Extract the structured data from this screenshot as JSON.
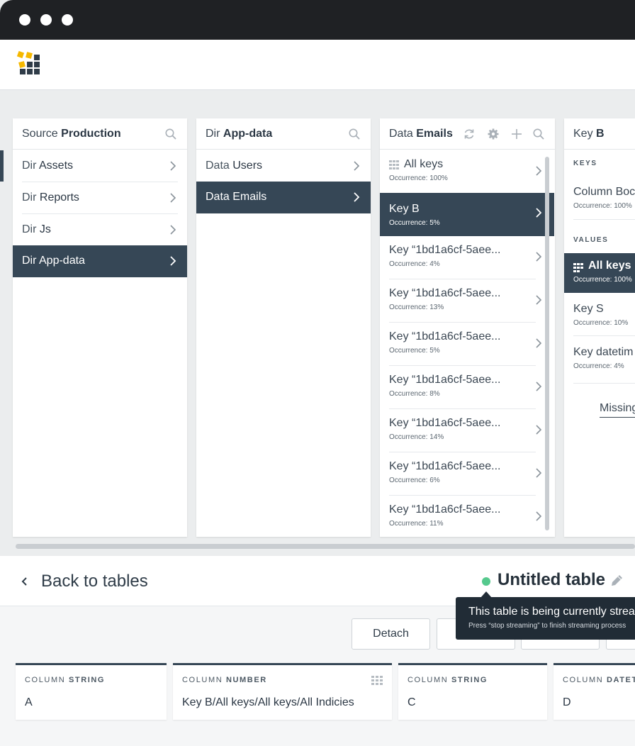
{
  "window": {
    "controls": [
      "close",
      "minimize",
      "maximize"
    ]
  },
  "app": {
    "logo_icon": "grid-logo-icon"
  },
  "panels": {
    "source": {
      "prefix": "Source",
      "name": "Production",
      "items": [
        {
          "prefix": "Dir",
          "name": "Assets"
        },
        {
          "prefix": "Dir",
          "name": "Reports"
        },
        {
          "prefix": "Dir",
          "name": "Js"
        },
        {
          "prefix": "Dir",
          "name": "App-data",
          "selected": true
        }
      ]
    },
    "dir": {
      "prefix": "Dir",
      "name": "App-data",
      "items": [
        {
          "prefix": "Data",
          "name": "Users"
        },
        {
          "prefix": "Data",
          "name": "Emails",
          "selected": true
        }
      ]
    },
    "data": {
      "prefix": "Data",
      "name": "Emails",
      "items": [
        {
          "label": "All keys",
          "occurrence": "Occurrence: 100%"
        },
        {
          "prefix": "Key",
          "name": "B",
          "occurrence": "Occurrence: 5%",
          "selected": true
        },
        {
          "prefix": "Key",
          "name": "“1bd1a6cf-5aee...",
          "occurrence": "Occurrence: 4%"
        },
        {
          "prefix": "Key",
          "name": "“1bd1a6cf-5aee...",
          "occurrence": "Occurrence: 13%"
        },
        {
          "prefix": "Key",
          "name": "“1bd1a6cf-5aee...",
          "occurrence": "Occurrence: 5%"
        },
        {
          "prefix": "Key",
          "name": "“1bd1a6cf-5aee...",
          "occurrence": "Occurrence: 8%"
        },
        {
          "prefix": "Key",
          "name": "“1bd1a6cf-5aee...",
          "occurrence": "Occurrence: 14%"
        },
        {
          "prefix": "Key",
          "name": "“1bd1a6cf-5aee...",
          "occurrence": "Occurrence: 6%"
        },
        {
          "prefix": "Key",
          "name": "“1bd1a6cf-5aee...",
          "occurrence": "Occurrence: 11%"
        }
      ]
    },
    "key": {
      "prefix": "Key",
      "name": "B",
      "keys_label": "KEYS",
      "keys": [
        {
          "prefix": "Column",
          "name": "Boc",
          "occurrence": "Occurrence: 100%"
        }
      ],
      "values_label": "VALUES",
      "values": [
        {
          "label": "All keys",
          "occurrence": "Occurrence: 100%",
          "selected": true
        },
        {
          "prefix": "Key",
          "name": "S",
          "occurrence": "Occurrence: 10%"
        },
        {
          "prefix": "Key",
          "name": "datetim",
          "occurrence": "Occurrence: 4%"
        }
      ],
      "missing_link": "Missing"
    }
  },
  "bottom": {
    "back_label": "Back to tables",
    "table_name": "Untitled table",
    "status_color": "#55c98d",
    "tooltip": {
      "title": "This table is being currently streaming",
      "subtitle": "Press “stop streaming” to finish streaming process"
    },
    "buttons": {
      "detach": "Detach"
    },
    "columns": [
      {
        "type": "COLUMN",
        "type_name": "STRING",
        "value": "A"
      },
      {
        "type": "COLUMN",
        "type_name": "NUMBER",
        "value": "Key B/All keys/All keys/All Indicies",
        "icon": "grid-icon"
      },
      {
        "type": "COLUMN",
        "type_name": "STRING",
        "value": "C"
      },
      {
        "type": "COLUMN",
        "type_name": "DATETIME",
        "value": "D"
      }
    ]
  },
  "colors": {
    "accent_dark": "#364756",
    "titlebar": "#1f2124",
    "logo_yellow": "#f5b800"
  }
}
